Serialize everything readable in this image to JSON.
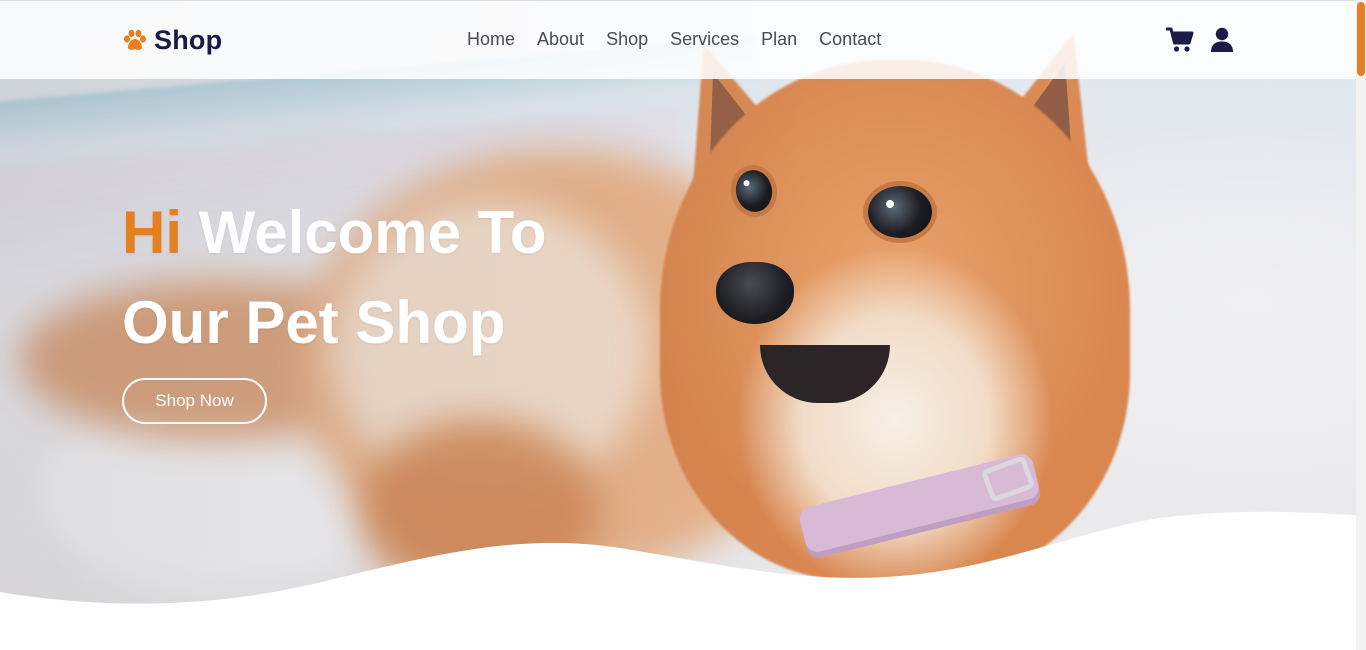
{
  "brand": {
    "name": "Shop",
    "icon": "paw-icon"
  },
  "nav": {
    "items": [
      {
        "label": "Home"
      },
      {
        "label": "About"
      },
      {
        "label": "Shop"
      },
      {
        "label": "Services"
      },
      {
        "label": "Plan"
      },
      {
        "label": "Contact"
      }
    ]
  },
  "header_icons": [
    "cart-icon",
    "user-icon"
  ],
  "hero": {
    "accent_word": "Hi",
    "title_rest": " Welcome To",
    "title_line2": "Our Pet Shop",
    "cta_label": "Shop Now"
  },
  "colors": {
    "accent": "#e4801f",
    "brand_dark": "#1b1b45",
    "nav_text": "#4a4a58",
    "hero_text": "#ffffff"
  }
}
